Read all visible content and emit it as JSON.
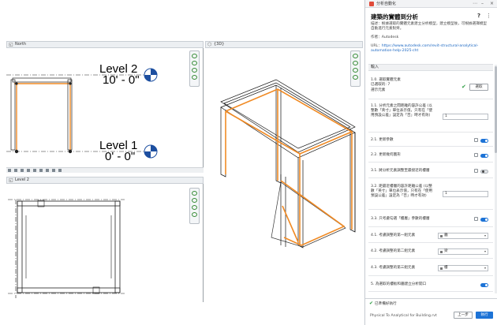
{
  "views": {
    "north": {
      "tab": "North"
    },
    "level2": {
      "tab": "Level 2"
    },
    "view3d": {
      "tab": "{3D}"
    },
    "level_2_head": {
      "name": "Level 2",
      "elev": "10' - 0\""
    },
    "level_1_head": {
      "name": "Level 1",
      "elev": "0' - 0\""
    }
  },
  "panel": {
    "window_title": "分析自動化",
    "heading": "建築的實體到分析",
    "description": "描述：根據選取的實體元素建立分析模型，建立模型後，可根據選擇模型自動進行元素對齊。",
    "author": "作者：Autodesk",
    "url_label": "URL：",
    "url": "https://www.autodesk.com/revit-structural-analytical-automation-help-2025-cht",
    "section_input": "輸入",
    "rows": [
      {
        "label": "1.0. 選取實體元素",
        "sub": "已選取的: 7",
        "link": "選示元素",
        "button": "選取"
      },
      {
        "label": "1.1. 分析元素之間距離的容許公差 (以整數「英寸」單位表示值，只有在「使用預設公差」設定為「否」時才有效)",
        "value": "1"
      },
      {
        "label": "2.1. 更新參數"
      },
      {
        "label": "2.2. 更新幾何圖形"
      },
      {
        "label": "3.1. 將分析元素調整至最接近的樓層"
      },
      {
        "label": "3.2. 距最近樓層的容許距離公差 (以整數「英寸」單位表示值，只有在「使用預設公差」設定為「否」時才有效)",
        "value": "1"
      },
      {
        "label": "3.3. 只考慮勾選「樓層」參數的樓層"
      },
      {
        "label": "4.1. 考慮調整的第一組元素",
        "select": "牆"
      },
      {
        "label": "4.2. 考慮調整的第二組元素",
        "select": "梁"
      },
      {
        "label": "4.3. 考慮調整的第三組元素",
        "select": "樓"
      },
      {
        "label": "5. 為選取的樓板和牆建立分析開口"
      }
    ],
    "status": "已準備好執行",
    "footer_path": "Physical To Analytical for Building.rvt",
    "back": "上一步",
    "run": "執行"
  },
  "colors": {
    "accent": "#1d73d6",
    "orange": "#f08a24",
    "ok": "#2f9e44"
  }
}
